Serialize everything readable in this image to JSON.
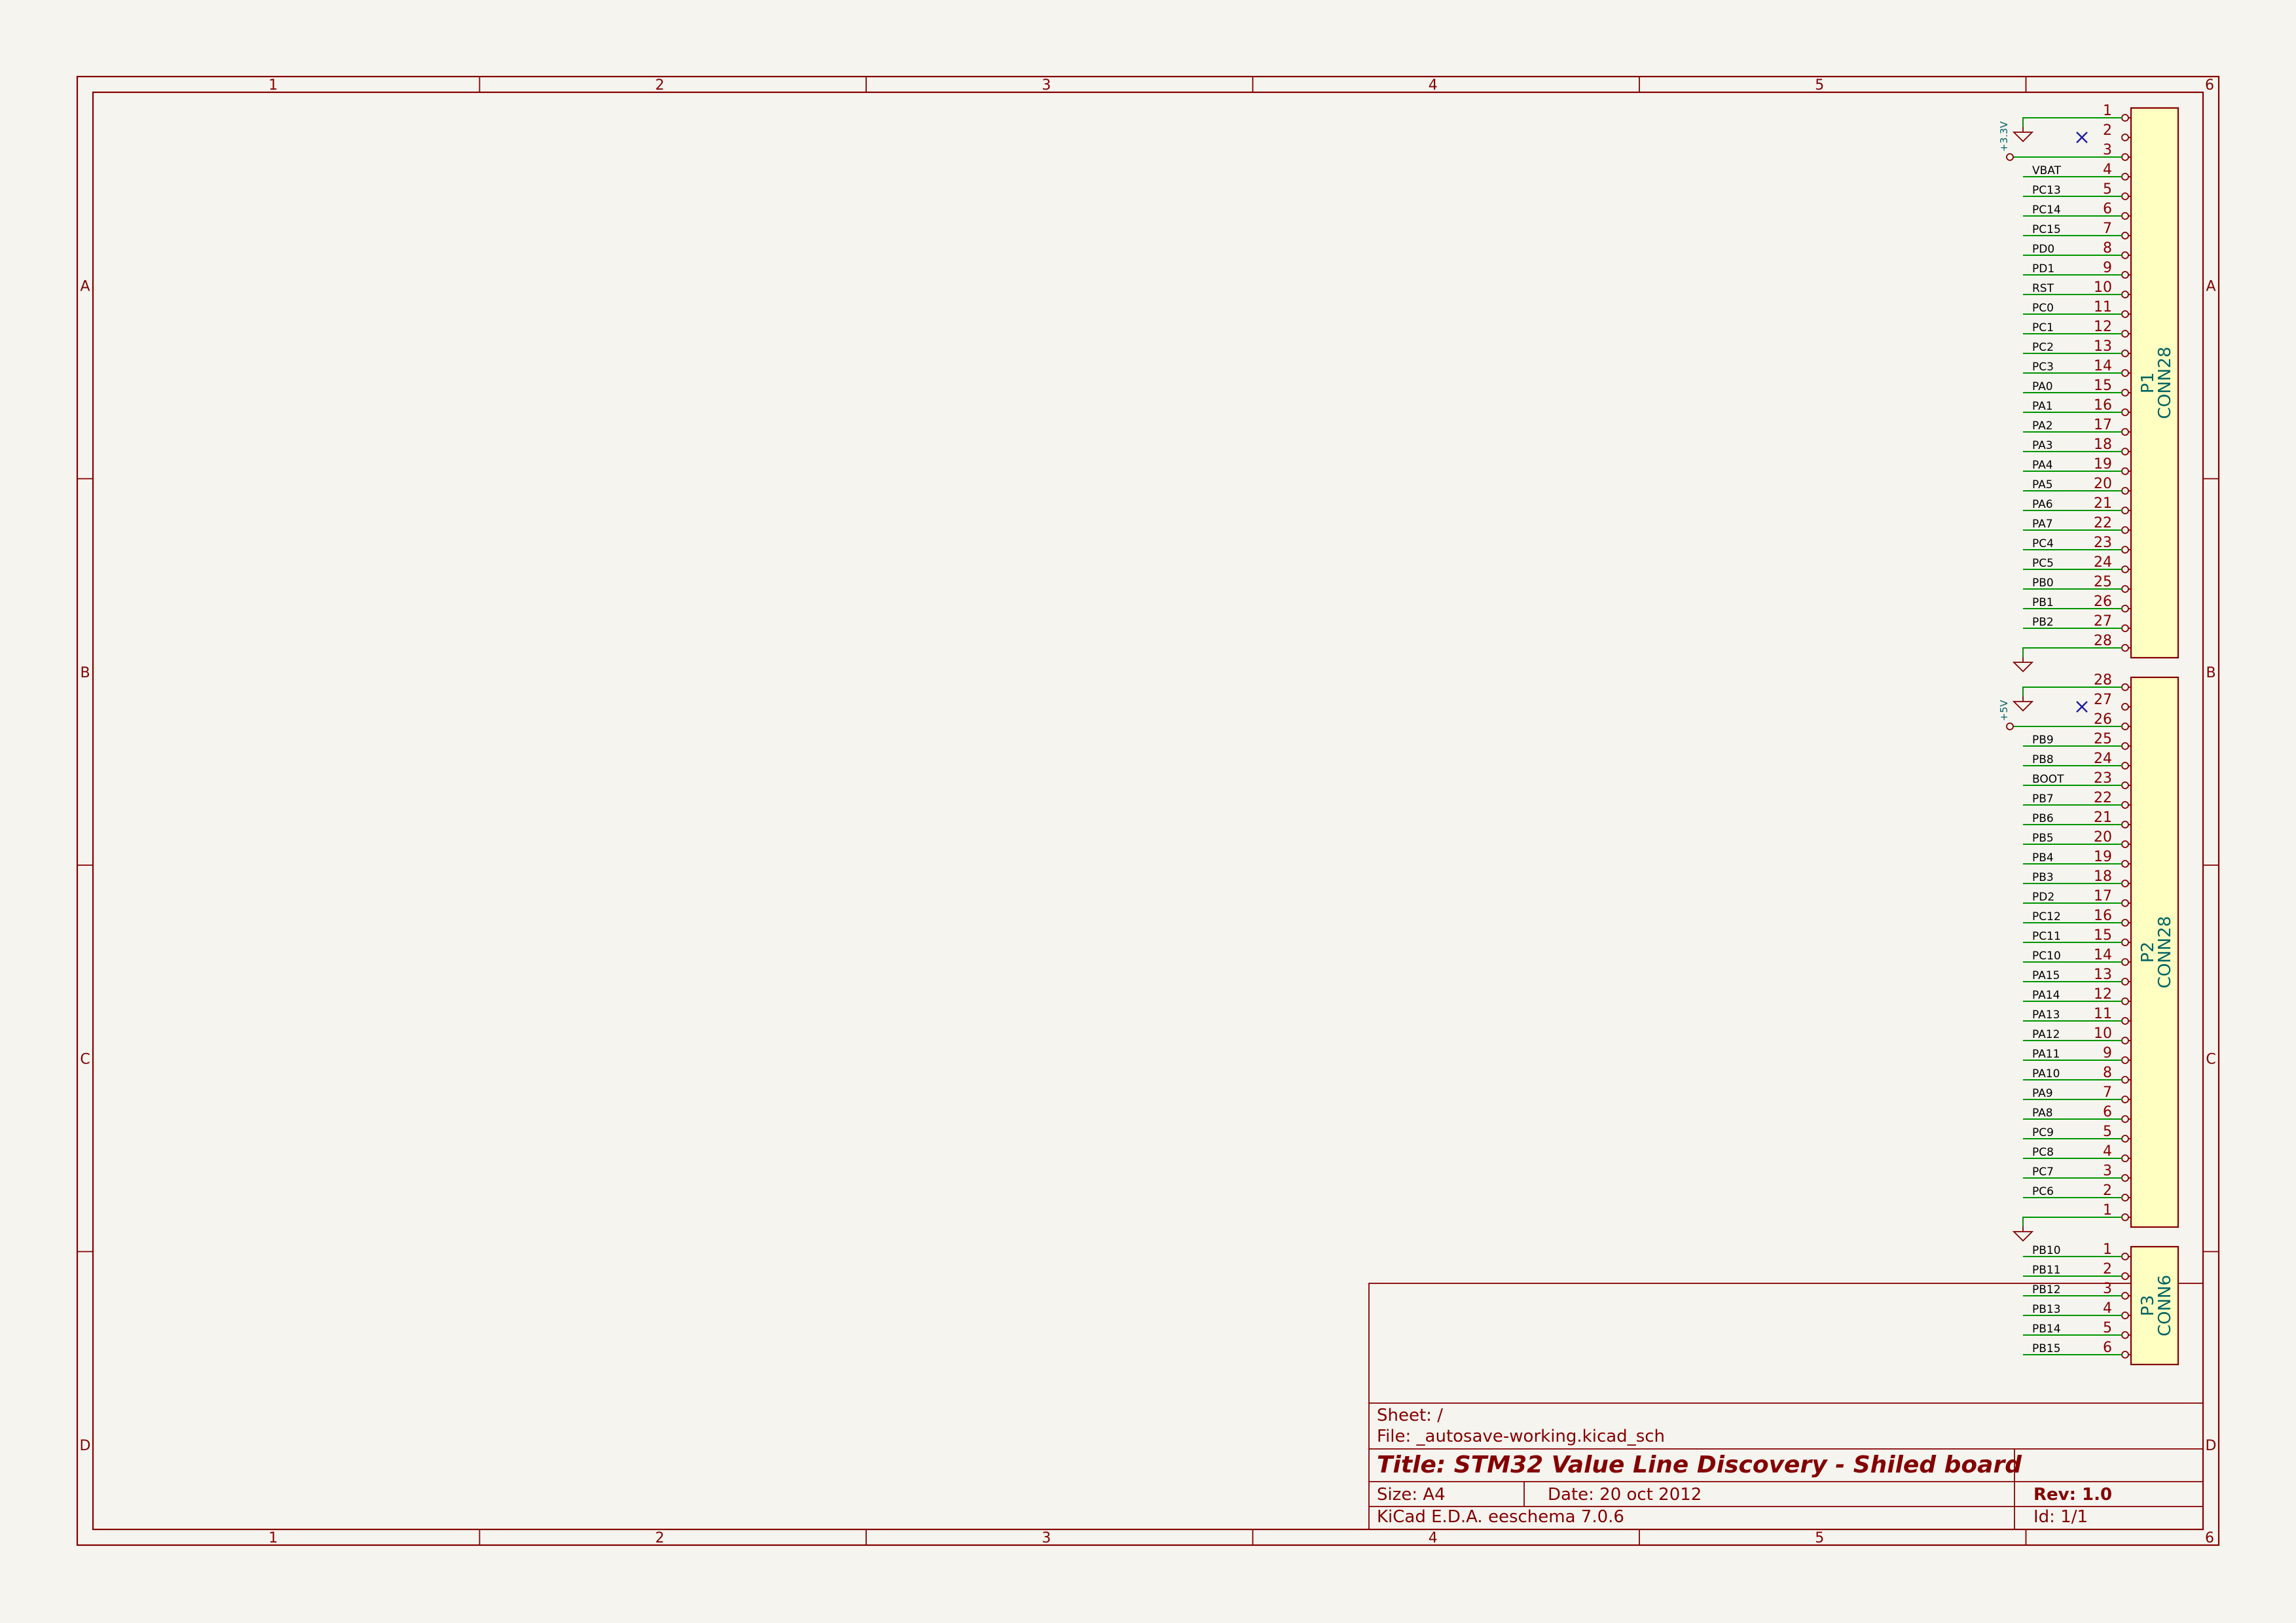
{
  "frame": {
    "columns": [
      "1",
      "2",
      "3",
      "4",
      "5",
      "6"
    ],
    "rows": [
      "A",
      "B",
      "C",
      "D"
    ]
  },
  "title_block": {
    "sheet": "Sheet: /",
    "file": "File: _autosave-working.kicad_sch",
    "title": "Title: STM32 Value Line Discovery - Shiled board",
    "size": "Size: A4",
    "date": "Date: 20 oct 2012",
    "rev": "Rev: 1.0",
    "tool": "KiCad E.D.A.  eeschema 7.0.6",
    "id": "Id: 1/1"
  },
  "connectors": [
    {
      "ref": "P1",
      "value": "CONN28",
      "pins": [
        {
          "num": "1",
          "net": "GND"
        },
        {
          "num": "2",
          "net": "NC"
        },
        {
          "num": "3",
          "net": "+3.3V"
        },
        {
          "num": "4",
          "net": "VBAT"
        },
        {
          "num": "5",
          "net": "PC13"
        },
        {
          "num": "6",
          "net": "PC14"
        },
        {
          "num": "7",
          "net": "PC15"
        },
        {
          "num": "8",
          "net": "PD0"
        },
        {
          "num": "9",
          "net": "PD1"
        },
        {
          "num": "10",
          "net": "RST"
        },
        {
          "num": "11",
          "net": "PC0"
        },
        {
          "num": "12",
          "net": "PC1"
        },
        {
          "num": "13",
          "net": "PC2"
        },
        {
          "num": "14",
          "net": "PC3"
        },
        {
          "num": "15",
          "net": "PA0"
        },
        {
          "num": "16",
          "net": "PA1"
        },
        {
          "num": "17",
          "net": "PA2"
        },
        {
          "num": "18",
          "net": "PA3"
        },
        {
          "num": "19",
          "net": "PA4"
        },
        {
          "num": "20",
          "net": "PA5"
        },
        {
          "num": "21",
          "net": "PA6"
        },
        {
          "num": "22",
          "net": "PA7"
        },
        {
          "num": "23",
          "net": "PC4"
        },
        {
          "num": "24",
          "net": "PC5"
        },
        {
          "num": "25",
          "net": "PB0"
        },
        {
          "num": "26",
          "net": "PB1"
        },
        {
          "num": "27",
          "net": "PB2"
        },
        {
          "num": "28",
          "net": "GND"
        }
      ]
    },
    {
      "ref": "P2",
      "value": "CONN28",
      "pins": [
        {
          "num": "28",
          "net": "GND"
        },
        {
          "num": "27",
          "net": "NC"
        },
        {
          "num": "26",
          "net": "+5V"
        },
        {
          "num": "25",
          "net": "PB9"
        },
        {
          "num": "24",
          "net": "PB8"
        },
        {
          "num": "23",
          "net": "BOOT"
        },
        {
          "num": "22",
          "net": "PB7"
        },
        {
          "num": "21",
          "net": "PB6"
        },
        {
          "num": "20",
          "net": "PB5"
        },
        {
          "num": "19",
          "net": "PB4"
        },
        {
          "num": "18",
          "net": "PB3"
        },
        {
          "num": "17",
          "net": "PD2"
        },
        {
          "num": "16",
          "net": "PC12"
        },
        {
          "num": "15",
          "net": "PC11"
        },
        {
          "num": "14",
          "net": "PC10"
        },
        {
          "num": "13",
          "net": "PA15"
        },
        {
          "num": "12",
          "net": "PA14"
        },
        {
          "num": "11",
          "net": "PA13"
        },
        {
          "num": "10",
          "net": "PA12"
        },
        {
          "num": "9",
          "net": "PA11"
        },
        {
          "num": "8",
          "net": "PA10"
        },
        {
          "num": "7",
          "net": "PA9"
        },
        {
          "num": "6",
          "net": "PA8"
        },
        {
          "num": "5",
          "net": "PC9"
        },
        {
          "num": "4",
          "net": "PC8"
        },
        {
          "num": "3",
          "net": "PC7"
        },
        {
          "num": "2",
          "net": "PC6"
        },
        {
          "num": "1",
          "net": "GND"
        }
      ]
    },
    {
      "ref": "P3",
      "value": "CONN6",
      "pins": [
        {
          "num": "1",
          "net": "PB10"
        },
        {
          "num": "2",
          "net": "PB11"
        },
        {
          "num": "3",
          "net": "PB12"
        },
        {
          "num": "4",
          "net": "PB13"
        },
        {
          "num": "5",
          "net": "PB14"
        },
        {
          "num": "6",
          "net": "PB15"
        }
      ]
    }
  ],
  "power_labels": {
    "v33": "+3.3V",
    "v5": "+5V"
  },
  "colors": {
    "frame": "#840000",
    "wire": "#009600",
    "component_fill": "#ffffc2",
    "reference": "#006464",
    "no_connect": "#2020a0",
    "background": "#f5f4ef"
  }
}
